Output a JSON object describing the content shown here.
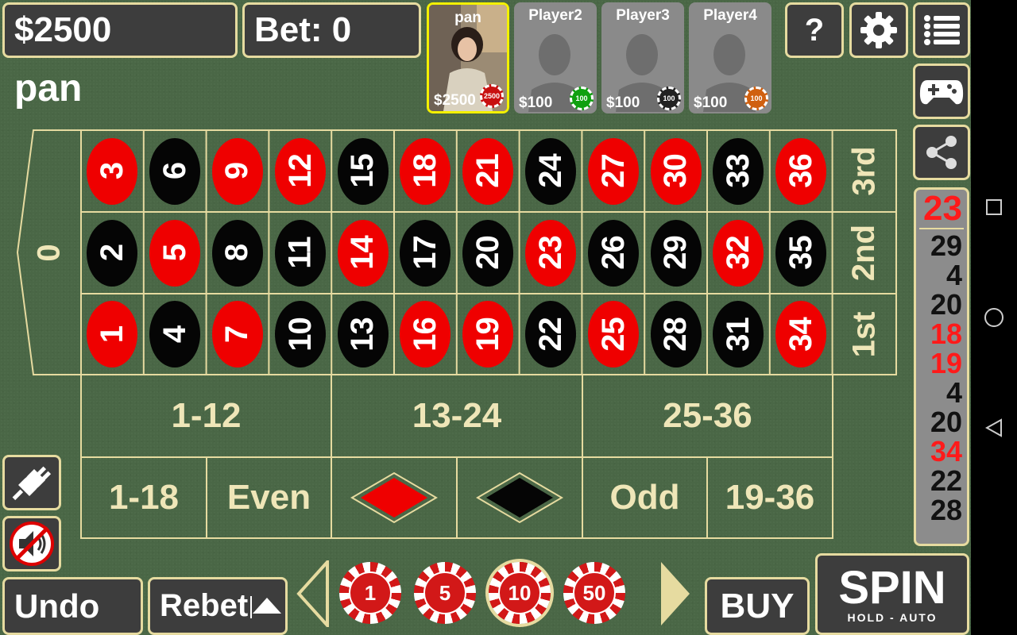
{
  "header": {
    "balance": "$2500",
    "bet": "Bet: 0",
    "help_label": "?"
  },
  "current_player": "pan",
  "players": [
    {
      "name": "pan",
      "balance": "$2500",
      "chip": "2500",
      "chip_color": "#c81010",
      "active": true
    },
    {
      "name": "Player2",
      "balance": "$100",
      "chip": "100",
      "chip_color": "#10a010",
      "active": false
    },
    {
      "name": "Player3",
      "balance": "$100",
      "chip": "100",
      "chip_color": "#222222",
      "active": false
    },
    {
      "name": "Player4",
      "balance": "$100",
      "chip": "100",
      "chip_color": "#d06010",
      "active": false
    }
  ],
  "table": {
    "zero": "0",
    "columns": [
      "3rd",
      "2nd",
      "1st"
    ],
    "dozens": [
      "1-12",
      "13-24",
      "25-36"
    ],
    "outside": {
      "low": "1-18",
      "even": "Even",
      "red_label": "red",
      "black_label": "black",
      "odd": "Odd",
      "high": "19-36"
    },
    "rows": [
      [
        "3",
        "6",
        "9",
        "12",
        "15",
        "18",
        "21",
        "24",
        "27",
        "30",
        "33",
        "36"
      ],
      [
        "2",
        "5",
        "8",
        "11",
        "14",
        "17",
        "20",
        "23",
        "26",
        "29",
        "32",
        "35"
      ],
      [
        "1",
        "4",
        "7",
        "10",
        "13",
        "16",
        "19",
        "22",
        "25",
        "28",
        "31",
        "34"
      ]
    ],
    "red_numbers": [
      "1",
      "3",
      "5",
      "7",
      "9",
      "12",
      "14",
      "16",
      "18",
      "19",
      "21",
      "23",
      "25",
      "27",
      "30",
      "32",
      "34",
      "36"
    ]
  },
  "history": [
    {
      "n": "23",
      "c": "red"
    },
    {
      "n": "29",
      "c": "black"
    },
    {
      "n": "4",
      "c": "black"
    },
    {
      "n": "20",
      "c": "black"
    },
    {
      "n": "18",
      "c": "red"
    },
    {
      "n": "19",
      "c": "red"
    },
    {
      "n": "4",
      "c": "black"
    },
    {
      "n": "20",
      "c": "black"
    },
    {
      "n": "34",
      "c": "red"
    },
    {
      "n": "22",
      "c": "black"
    },
    {
      "n": "28",
      "c": "black"
    }
  ],
  "bottom": {
    "undo": "Undo",
    "rebet": "Rebet",
    "chips": [
      "1",
      "5",
      "10",
      "50"
    ],
    "selected_chip": "10",
    "buy": "BUY",
    "spin": "SPIN",
    "spin_sub": "HOLD - AUTO"
  },
  "colors": {
    "felt": "#4a6746",
    "line": "#e6dba0",
    "red": "#ef0000",
    "black": "#050505"
  }
}
